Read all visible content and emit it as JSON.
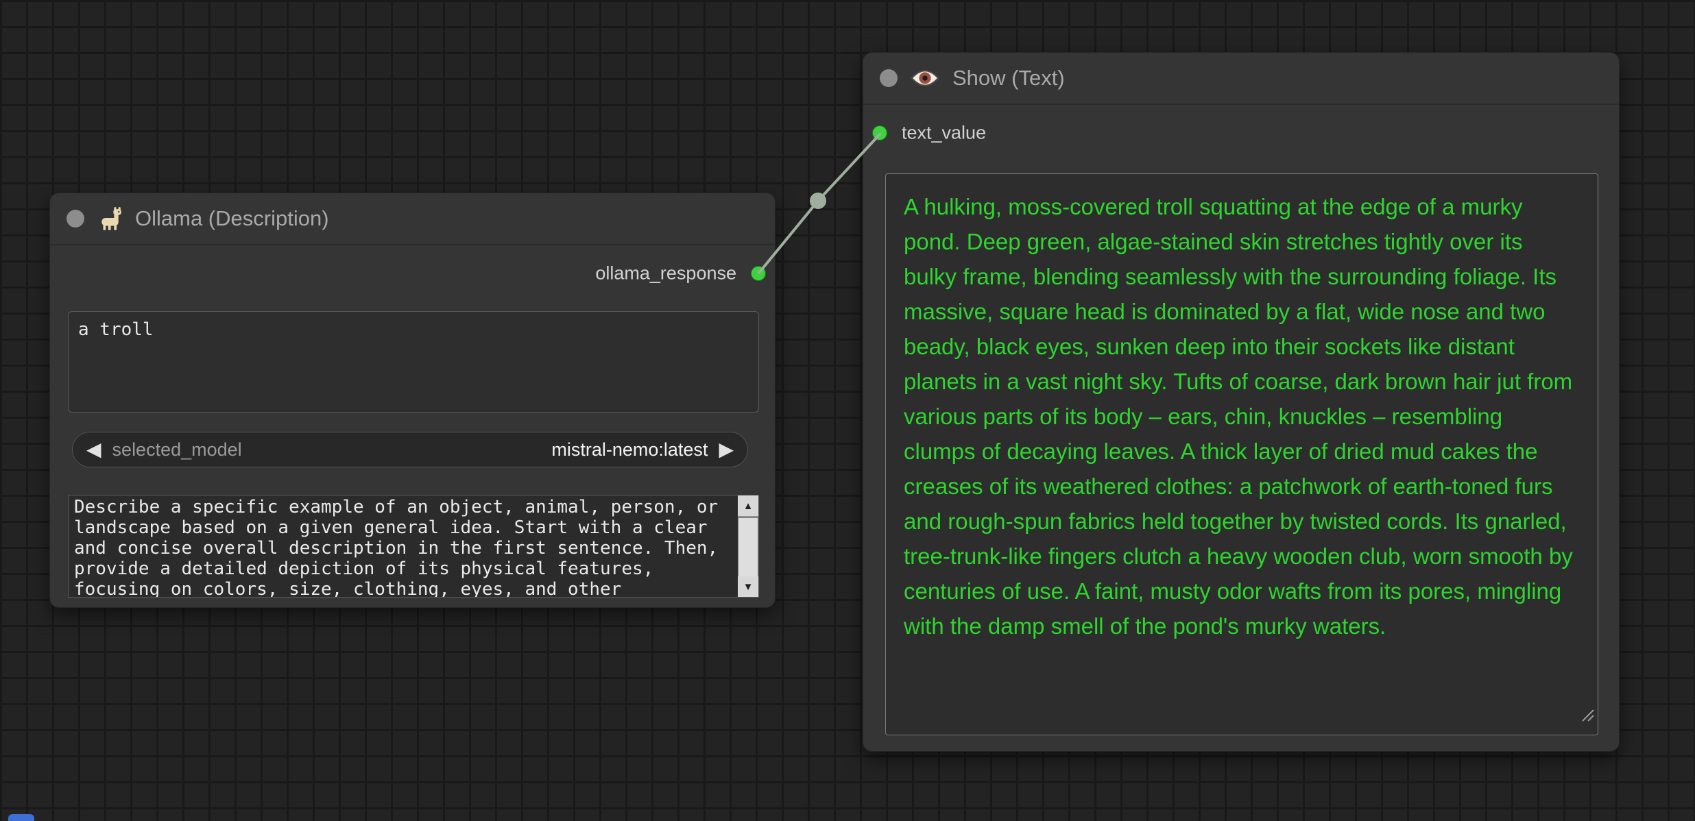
{
  "canvas": {
    "bg_color": "#232323",
    "grid_line_color": "#191919"
  },
  "colors": {
    "node_bg": "#353535",
    "node_title_text": "#a9a9a9",
    "slot_green": "#3fd23f",
    "link_color": "#9fae9f",
    "show_text_green": "#2ed52e"
  },
  "icons": {
    "prev_arrow": "◀",
    "next_arrow": "▶",
    "scroll_up": "▲",
    "scroll_down": "▼"
  },
  "link": {
    "from": "ollama_response",
    "to": "text_value"
  },
  "nodes": {
    "ollama": {
      "title": "Ollama (Description)",
      "output_label": "ollama_response",
      "prompt_value": "a troll",
      "model_widget": {
        "label": "selected_model",
        "value": "mistral-nemo:latest"
      },
      "system_prompt": "Describe a specific example of an object, animal, person, or landscape based on a given general idea. Start with a clear and concise overall description in the first sentence. Then, provide a detailed depiction of its physical features, focusing on colors, size, clothing, eyes, and other"
    },
    "show_text": {
      "title": "Show (Text)",
      "input_label": "text_value",
      "text_value": "A hulking, moss-covered troll squatting at the edge of a murky pond. Deep green, algae-stained skin stretches tightly over its bulky frame, blending seamlessly with the surrounding foliage. Its massive, square head is dominated by a flat, wide nose and two beady, black eyes, sunken deep into their sockets like distant planets in a vast night sky. Tufts of coarse, dark brown hair jut from various parts of its body – ears, chin, knuckles – resembling clumps of decaying leaves. A thick layer of dried mud cakes the creases of its weathered clothes: a patchwork of earth-toned furs and rough-spun fabrics held together by twisted cords. Its gnarled, tree-trunk-like fingers clutch a heavy wooden club, worn smooth by centuries of use. A faint, musty odor wafts from its pores, mingling with the damp smell of the pond's murky waters."
    }
  }
}
